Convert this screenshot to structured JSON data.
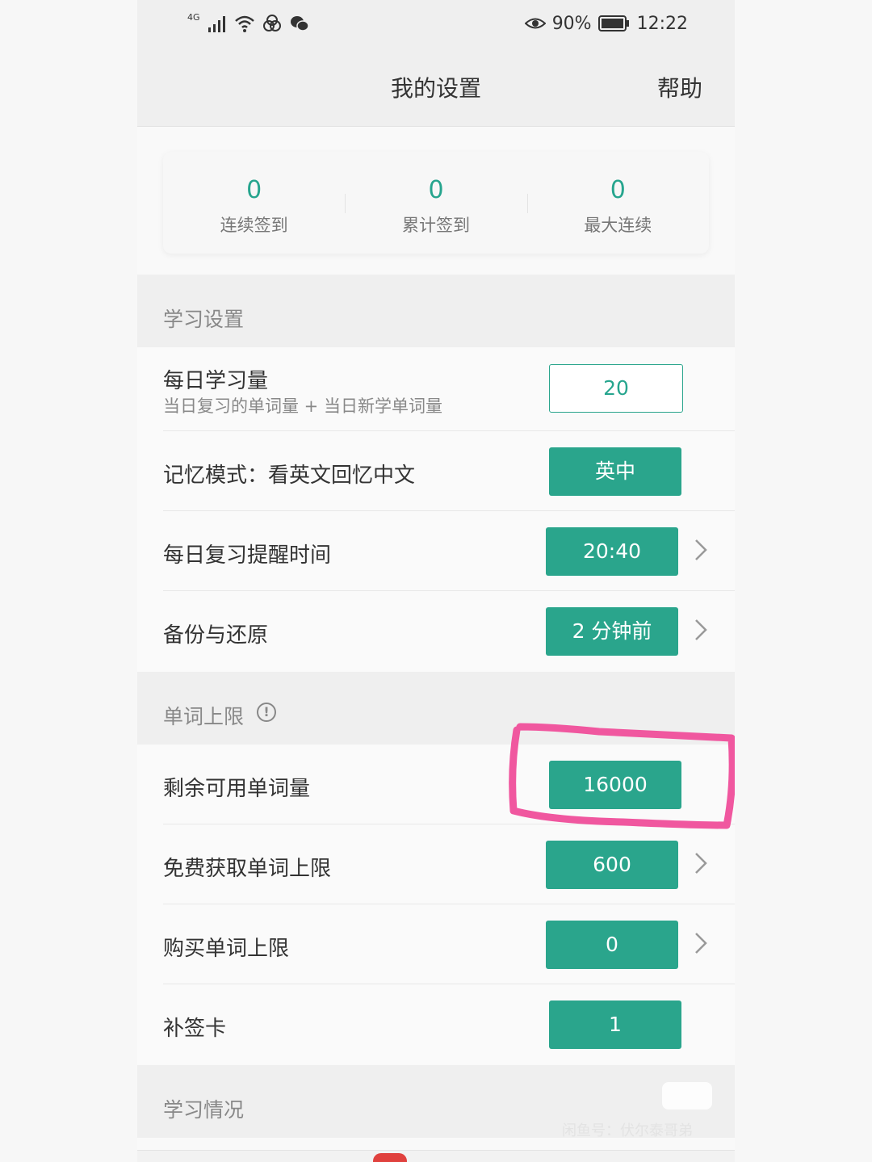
{
  "statusbar": {
    "network": "4G",
    "battery": "90%",
    "time": "12:22"
  },
  "header": {
    "title": "我的设置",
    "help": "帮助"
  },
  "stats": [
    {
      "value": "0",
      "label": "连续签到"
    },
    {
      "value": "0",
      "label": "累计签到"
    },
    {
      "value": "0",
      "label": "最大连续"
    }
  ],
  "sections": {
    "study": "学习设置",
    "limit": "单词上限",
    "status": "学习情况"
  },
  "rows": {
    "daily": {
      "label": "每日学习量",
      "sub": "当日复习的单词量 + 当日新学单词量",
      "value": "20"
    },
    "memory": {
      "label": "记忆模式：看英文回忆中文",
      "value": "英中"
    },
    "reminder": {
      "label": "每日复习提醒时间",
      "value": "20:40"
    },
    "backup": {
      "label": "备份与还原",
      "value": "2 分钟前"
    },
    "remaining": {
      "label": "剩余可用单词量",
      "value": "16000"
    },
    "free": {
      "label": "免费获取单词上限",
      "value": "600"
    },
    "buy": {
      "label": "购买单词上限",
      "value": "0"
    },
    "makeup": {
      "label": "补签卡",
      "value": "1"
    }
  },
  "watermark": {
    "logo": "闲鱼",
    "text": "闲鱼号：伏尔泰哥弟"
  },
  "colors": {
    "accent": "#2aa58c",
    "highlight": "#f0579f"
  }
}
